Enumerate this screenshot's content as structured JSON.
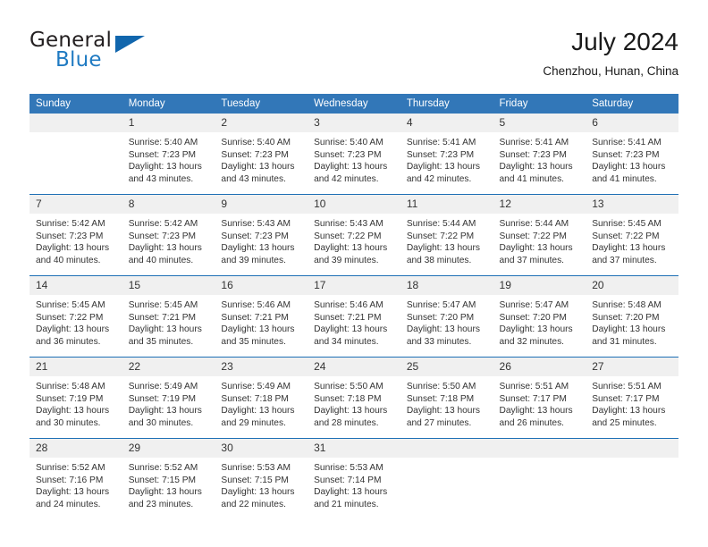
{
  "brand": {
    "name_part1": "General",
    "name_part2": "Blue",
    "logo_icon": "triangle-logo"
  },
  "header": {
    "month_title": "July 2024",
    "location": "Chenzhou, Hunan, China"
  },
  "colors": {
    "header_blue": "#3277b8",
    "row_divider_blue": "#1d6fb5",
    "daynum_band": "#f0f0f0",
    "brand_blue": "#1f7ac2"
  },
  "calendar": {
    "weekday_headers": [
      "Sunday",
      "Monday",
      "Tuesday",
      "Wednesday",
      "Thursday",
      "Friday",
      "Saturday"
    ],
    "weeks": [
      [
        {
          "day": "",
          "sunrise": "",
          "sunset": "",
          "daylight_line1": "",
          "daylight_line2": ""
        },
        {
          "day": "1",
          "sunrise": "Sunrise: 5:40 AM",
          "sunset": "Sunset: 7:23 PM",
          "daylight_line1": "Daylight: 13 hours",
          "daylight_line2": "and 43 minutes."
        },
        {
          "day": "2",
          "sunrise": "Sunrise: 5:40 AM",
          "sunset": "Sunset: 7:23 PM",
          "daylight_line1": "Daylight: 13 hours",
          "daylight_line2": "and 43 minutes."
        },
        {
          "day": "3",
          "sunrise": "Sunrise: 5:40 AM",
          "sunset": "Sunset: 7:23 PM",
          "daylight_line1": "Daylight: 13 hours",
          "daylight_line2": "and 42 minutes."
        },
        {
          "day": "4",
          "sunrise": "Sunrise: 5:41 AM",
          "sunset": "Sunset: 7:23 PM",
          "daylight_line1": "Daylight: 13 hours",
          "daylight_line2": "and 42 minutes."
        },
        {
          "day": "5",
          "sunrise": "Sunrise: 5:41 AM",
          "sunset": "Sunset: 7:23 PM",
          "daylight_line1": "Daylight: 13 hours",
          "daylight_line2": "and 41 minutes."
        },
        {
          "day": "6",
          "sunrise": "Sunrise: 5:41 AM",
          "sunset": "Sunset: 7:23 PM",
          "daylight_line1": "Daylight: 13 hours",
          "daylight_line2": "and 41 minutes."
        }
      ],
      [
        {
          "day": "7",
          "sunrise": "Sunrise: 5:42 AM",
          "sunset": "Sunset: 7:23 PM",
          "daylight_line1": "Daylight: 13 hours",
          "daylight_line2": "and 40 minutes."
        },
        {
          "day": "8",
          "sunrise": "Sunrise: 5:42 AM",
          "sunset": "Sunset: 7:23 PM",
          "daylight_line1": "Daylight: 13 hours",
          "daylight_line2": "and 40 minutes."
        },
        {
          "day": "9",
          "sunrise": "Sunrise: 5:43 AM",
          "sunset": "Sunset: 7:23 PM",
          "daylight_line1": "Daylight: 13 hours",
          "daylight_line2": "and 39 minutes."
        },
        {
          "day": "10",
          "sunrise": "Sunrise: 5:43 AM",
          "sunset": "Sunset: 7:22 PM",
          "daylight_line1": "Daylight: 13 hours",
          "daylight_line2": "and 39 minutes."
        },
        {
          "day": "11",
          "sunrise": "Sunrise: 5:44 AM",
          "sunset": "Sunset: 7:22 PM",
          "daylight_line1": "Daylight: 13 hours",
          "daylight_line2": "and 38 minutes."
        },
        {
          "day": "12",
          "sunrise": "Sunrise: 5:44 AM",
          "sunset": "Sunset: 7:22 PM",
          "daylight_line1": "Daylight: 13 hours",
          "daylight_line2": "and 37 minutes."
        },
        {
          "day": "13",
          "sunrise": "Sunrise: 5:45 AM",
          "sunset": "Sunset: 7:22 PM",
          "daylight_line1": "Daylight: 13 hours",
          "daylight_line2": "and 37 minutes."
        }
      ],
      [
        {
          "day": "14",
          "sunrise": "Sunrise: 5:45 AM",
          "sunset": "Sunset: 7:22 PM",
          "daylight_line1": "Daylight: 13 hours",
          "daylight_line2": "and 36 minutes."
        },
        {
          "day": "15",
          "sunrise": "Sunrise: 5:45 AM",
          "sunset": "Sunset: 7:21 PM",
          "daylight_line1": "Daylight: 13 hours",
          "daylight_line2": "and 35 minutes."
        },
        {
          "day": "16",
          "sunrise": "Sunrise: 5:46 AM",
          "sunset": "Sunset: 7:21 PM",
          "daylight_line1": "Daylight: 13 hours",
          "daylight_line2": "and 35 minutes."
        },
        {
          "day": "17",
          "sunrise": "Sunrise: 5:46 AM",
          "sunset": "Sunset: 7:21 PM",
          "daylight_line1": "Daylight: 13 hours",
          "daylight_line2": "and 34 minutes."
        },
        {
          "day": "18",
          "sunrise": "Sunrise: 5:47 AM",
          "sunset": "Sunset: 7:20 PM",
          "daylight_line1": "Daylight: 13 hours",
          "daylight_line2": "and 33 minutes."
        },
        {
          "day": "19",
          "sunrise": "Sunrise: 5:47 AM",
          "sunset": "Sunset: 7:20 PM",
          "daylight_line1": "Daylight: 13 hours",
          "daylight_line2": "and 32 minutes."
        },
        {
          "day": "20",
          "sunrise": "Sunrise: 5:48 AM",
          "sunset": "Sunset: 7:20 PM",
          "daylight_line1": "Daylight: 13 hours",
          "daylight_line2": "and 31 minutes."
        }
      ],
      [
        {
          "day": "21",
          "sunrise": "Sunrise: 5:48 AM",
          "sunset": "Sunset: 7:19 PM",
          "daylight_line1": "Daylight: 13 hours",
          "daylight_line2": "and 30 minutes."
        },
        {
          "day": "22",
          "sunrise": "Sunrise: 5:49 AM",
          "sunset": "Sunset: 7:19 PM",
          "daylight_line1": "Daylight: 13 hours",
          "daylight_line2": "and 30 minutes."
        },
        {
          "day": "23",
          "sunrise": "Sunrise: 5:49 AM",
          "sunset": "Sunset: 7:18 PM",
          "daylight_line1": "Daylight: 13 hours",
          "daylight_line2": "and 29 minutes."
        },
        {
          "day": "24",
          "sunrise": "Sunrise: 5:50 AM",
          "sunset": "Sunset: 7:18 PM",
          "daylight_line1": "Daylight: 13 hours",
          "daylight_line2": "and 28 minutes."
        },
        {
          "day": "25",
          "sunrise": "Sunrise: 5:50 AM",
          "sunset": "Sunset: 7:18 PM",
          "daylight_line1": "Daylight: 13 hours",
          "daylight_line2": "and 27 minutes."
        },
        {
          "day": "26",
          "sunrise": "Sunrise: 5:51 AM",
          "sunset": "Sunset: 7:17 PM",
          "daylight_line1": "Daylight: 13 hours",
          "daylight_line2": "and 26 minutes."
        },
        {
          "day": "27",
          "sunrise": "Sunrise: 5:51 AM",
          "sunset": "Sunset: 7:17 PM",
          "daylight_line1": "Daylight: 13 hours",
          "daylight_line2": "and 25 minutes."
        }
      ],
      [
        {
          "day": "28",
          "sunrise": "Sunrise: 5:52 AM",
          "sunset": "Sunset: 7:16 PM",
          "daylight_line1": "Daylight: 13 hours",
          "daylight_line2": "and 24 minutes."
        },
        {
          "day": "29",
          "sunrise": "Sunrise: 5:52 AM",
          "sunset": "Sunset: 7:15 PM",
          "daylight_line1": "Daylight: 13 hours",
          "daylight_line2": "and 23 minutes."
        },
        {
          "day": "30",
          "sunrise": "Sunrise: 5:53 AM",
          "sunset": "Sunset: 7:15 PM",
          "daylight_line1": "Daylight: 13 hours",
          "daylight_line2": "and 22 minutes."
        },
        {
          "day": "31",
          "sunrise": "Sunrise: 5:53 AM",
          "sunset": "Sunset: 7:14 PM",
          "daylight_line1": "Daylight: 13 hours",
          "daylight_line2": "and 21 minutes."
        },
        {
          "day": "",
          "sunrise": "",
          "sunset": "",
          "daylight_line1": "",
          "daylight_line2": ""
        },
        {
          "day": "",
          "sunrise": "",
          "sunset": "",
          "daylight_line1": "",
          "daylight_line2": ""
        },
        {
          "day": "",
          "sunrise": "",
          "sunset": "",
          "daylight_line1": "",
          "daylight_line2": ""
        }
      ]
    ]
  }
}
